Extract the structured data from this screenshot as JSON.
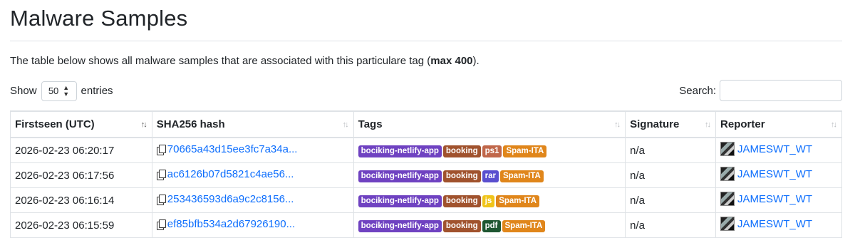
{
  "page": {
    "title": "Malware Samples",
    "description_prefix": "The table below shows all malware samples that are associated with this particulare tag (",
    "description_bold": "max 400",
    "description_suffix": ")."
  },
  "length_control": {
    "show_label": "Show",
    "value": "50",
    "entries_label": "entries"
  },
  "search": {
    "label": "Search:",
    "value": ""
  },
  "columns": [
    {
      "label": "Firstseen (UTC)",
      "sorted": true
    },
    {
      "label": "SHA256 hash",
      "sorted": false
    },
    {
      "label": "Tags",
      "sorted": false
    },
    {
      "label": "Signature",
      "sorted": false
    },
    {
      "label": "Reporter",
      "sorted": false
    }
  ],
  "colors": {
    "link": "#0d6efd",
    "tag_bociking": "#6f42c1",
    "tag_booking": "#a0522d",
    "tag_ps1": "#c0674a",
    "tag_rar": "#5a4fcf",
    "tag_js": "#f0c419",
    "tag_pdf": "#1e5631",
    "tag_spam": "#e0861b"
  },
  "rows": [
    {
      "firstseen": "2026-02-23 06:20:17",
      "hash": "70665a43d15ee3fc7a34a...",
      "tags": [
        {
          "label": "bociking-netlify-app",
          "color": "#6f42c1"
        },
        {
          "label": "booking",
          "color": "#a0522d"
        },
        {
          "label": "ps1",
          "color": "#c0674a"
        },
        {
          "label": "Spam-ITA",
          "color": "#e0861b"
        }
      ],
      "signature": "n/a",
      "reporter": "JAMESWT_WT"
    },
    {
      "firstseen": "2026-02-23 06:17:56",
      "hash": "ac6126b07d5821c4ae56...",
      "tags": [
        {
          "label": "bociking-netlify-app",
          "color": "#6f42c1"
        },
        {
          "label": "booking",
          "color": "#a0522d"
        },
        {
          "label": "rar",
          "color": "#5a4fcf"
        },
        {
          "label": "Spam-ITA",
          "color": "#e0861b"
        }
      ],
      "signature": "n/a",
      "reporter": "JAMESWT_WT"
    },
    {
      "firstseen": "2026-02-23 06:16:14",
      "hash": "253436593d6a9c2c8156...",
      "tags": [
        {
          "label": "bociking-netlify-app",
          "color": "#6f42c1"
        },
        {
          "label": "booking",
          "color": "#a0522d"
        },
        {
          "label": "js",
          "color": "#f0c419"
        },
        {
          "label": "Spam-ITA",
          "color": "#e0861b"
        }
      ],
      "signature": "n/a",
      "reporter": "JAMESWT_WT"
    },
    {
      "firstseen": "2026-02-23 06:15:59",
      "hash": "ef85bfb534a2d67926190...",
      "tags": [
        {
          "label": "bociking-netlify-app",
          "color": "#6f42c1"
        },
        {
          "label": "booking",
          "color": "#a0522d"
        },
        {
          "label": "pdf",
          "color": "#1e5631"
        },
        {
          "label": "Spam-ITA",
          "color": "#e0861b"
        }
      ],
      "signature": "n/a",
      "reporter": "JAMESWT_WT"
    }
  ]
}
